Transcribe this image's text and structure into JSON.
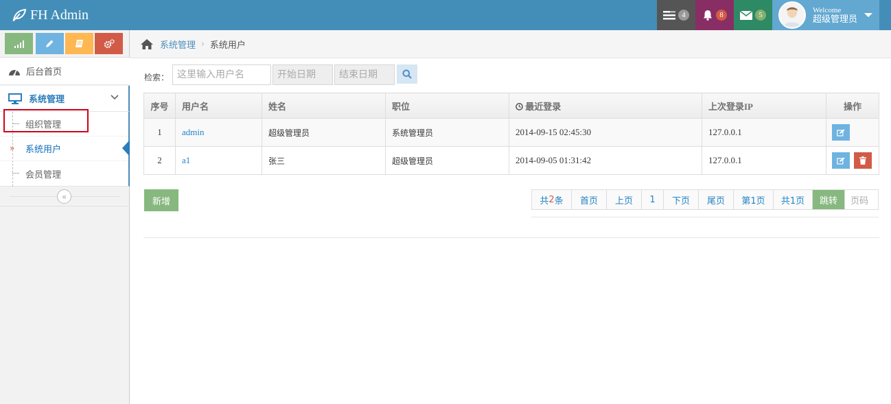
{
  "app": {
    "brand": "FH Admin"
  },
  "navbar": {
    "tasks_count": "4",
    "notifications_count": "8",
    "messages_count": "5",
    "welcome": "Welcome",
    "username": "超级管理员"
  },
  "sidebar": {
    "home_label": "后台首页",
    "section_label": "系统管理",
    "items": [
      {
        "label": "组织管理"
      },
      {
        "label": "系统用户"
      },
      {
        "label": "会员管理"
      }
    ],
    "collapse_glyph": "«"
  },
  "breadcrumb": {
    "parent": "系统管理",
    "current": "系统用户"
  },
  "search": {
    "label": "检索：",
    "name_placeholder": "这里输入用户名",
    "start_placeholder": "开始日期",
    "end_placeholder": "结束日期"
  },
  "table": {
    "headers": {
      "no": "序号",
      "username": "用户名",
      "name": "姓名",
      "position": "职位",
      "last_login": "最近登录",
      "last_ip": "上次登录IP",
      "ops": "操作"
    },
    "rows": [
      {
        "no": "1",
        "username": "admin",
        "name": "超级管理员",
        "position": "系统管理员",
        "last_login": "2014-09-15 02:45:30",
        "last_ip": "127.0.0.1"
      },
      {
        "no": "2",
        "username": "a1",
        "name": "张三",
        "position": "超级管理员",
        "last_login": "2014-09-05 01:31:42",
        "last_ip": "127.0.0.1"
      }
    ]
  },
  "actions": {
    "add_label": "新增"
  },
  "pager": {
    "total_prefix": "共",
    "total_count": "2",
    "total_suffix": "条",
    "first": "首页",
    "prev": "上页",
    "current": "1",
    "next": "下页",
    "last": "尾页",
    "page_info": "第1页",
    "page_total": "共1页",
    "jump": "跳转",
    "page_placeholder": "页码"
  },
  "colors": {
    "navbar": "#438eb9",
    "accent": "#2b7dbc",
    "success": "#87b87f",
    "danger": "#d15b47"
  }
}
